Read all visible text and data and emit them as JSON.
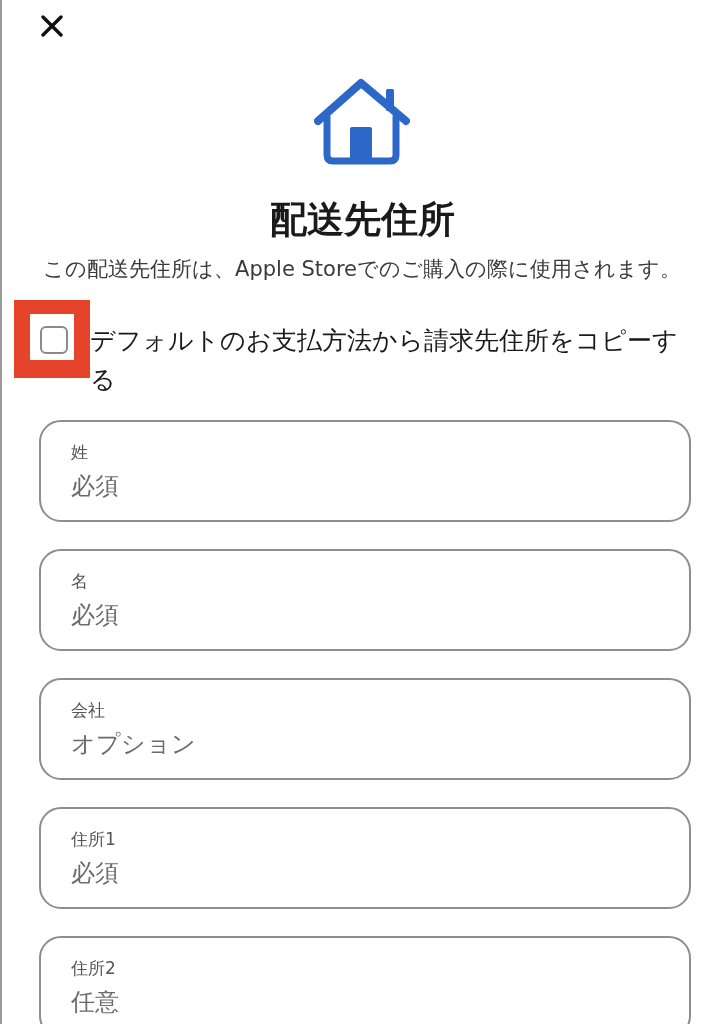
{
  "header": {
    "title": "配送先住所",
    "description": "この配送先住所は、Apple Storeでのご購入の際に使用されます。"
  },
  "copy_billing": {
    "label": "デフォルトのお支払方法から請求先住所をコピーする",
    "checked": false,
    "highlighted": true
  },
  "fields": [
    {
      "label": "姓",
      "placeholder": "必須"
    },
    {
      "label": "名",
      "placeholder": "必須"
    },
    {
      "label": "会社",
      "placeholder": "オプション"
    },
    {
      "label": "住所1",
      "placeholder": "必須"
    },
    {
      "label": "住所2",
      "placeholder": "任意"
    }
  ]
}
